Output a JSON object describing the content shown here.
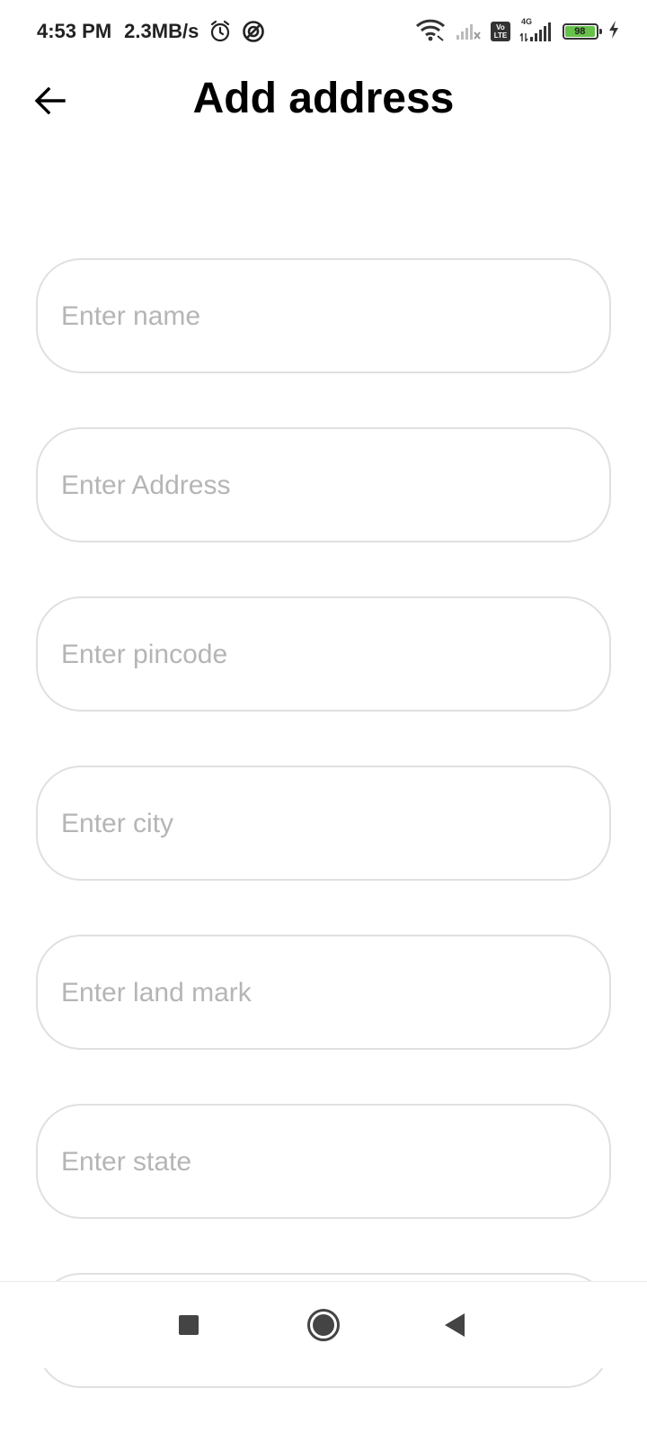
{
  "status_bar": {
    "time": "4:53 PM",
    "network_speed": "2.3MB/s",
    "volte_top": "Vo",
    "volte_bottom": "LTE",
    "network_type": "4G",
    "battery_level": "98",
    "icons": [
      "alarm-icon",
      "hotspot-icon",
      "wifi-icon",
      "signal-icon",
      "volte-icon",
      "signal-4g-icon",
      "battery-icon",
      "charging-icon"
    ]
  },
  "header": {
    "title": "Add address",
    "back_icon": "arrow-left-icon"
  },
  "form": {
    "name_placeholder": "Enter name",
    "address_placeholder": "Enter Address",
    "pincode_placeholder": "Enter pincode",
    "city_placeholder": "Enter city",
    "landmark_placeholder": "Enter land mark",
    "state_placeholder": "Enter state"
  },
  "nav_bar": {
    "icons": [
      "recents-square-icon",
      "home-circle-icon",
      "back-triangle-icon"
    ]
  },
  "colors": {
    "field_border": "#e0e0e0",
    "placeholder": "#b5b5b5",
    "battery_fill": "#66c14a"
  }
}
